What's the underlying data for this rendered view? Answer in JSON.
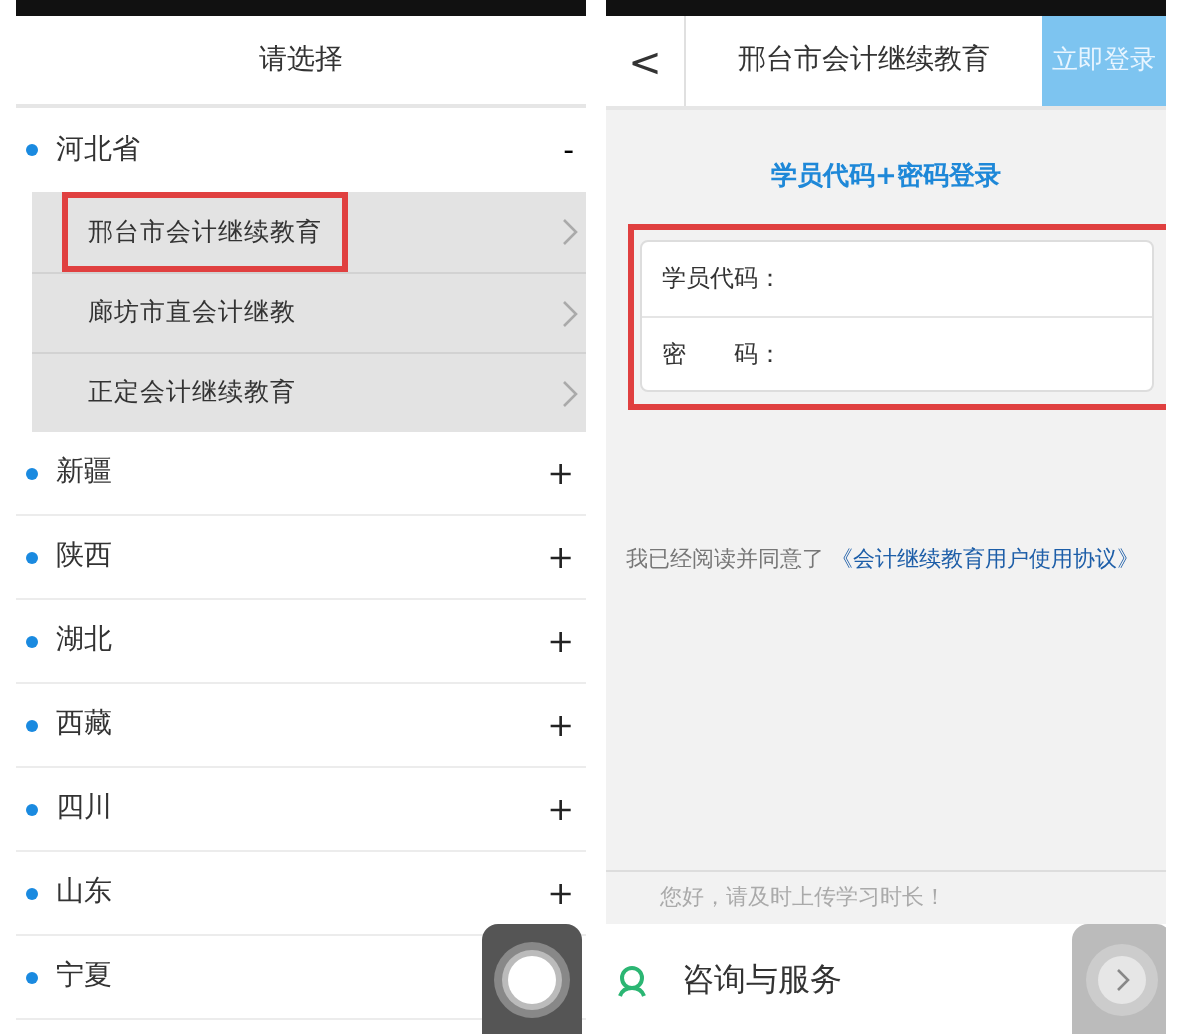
{
  "left_screen": {
    "title": "请选择",
    "provinces": [
      {
        "name": "河北省",
        "expanded": true,
        "toggle": "-",
        "children": [
          {
            "name": "邢台市会计继续教育",
            "highlighted": true
          },
          {
            "name": "廊坊市直会计继教",
            "highlighted": false
          },
          {
            "name": "正定会计继续教育",
            "highlighted": false
          }
        ]
      },
      {
        "name": "新疆",
        "expanded": false,
        "toggle": "+"
      },
      {
        "name": "陕西",
        "expanded": false,
        "toggle": "+"
      },
      {
        "name": "湖北",
        "expanded": false,
        "toggle": "+"
      },
      {
        "name": "西藏",
        "expanded": false,
        "toggle": "+"
      },
      {
        "name": "四川",
        "expanded": false,
        "toggle": "+"
      },
      {
        "name": "山东",
        "expanded": false,
        "toggle": "+"
      },
      {
        "name": "宁夏",
        "expanded": false
      }
    ]
  },
  "right_screen": {
    "back": "<",
    "title": "邢台市会计继续教育",
    "login_button": "立即登录",
    "form_title": "学员代码+密码登录",
    "form_highlighted": true,
    "fields": [
      {
        "label": "学员代码："
      },
      {
        "label": "密　　码："
      }
    ],
    "agreement": {
      "text": "我已经阅读并同意了",
      "link": "《会计继续教育用户使用协议》"
    },
    "notice": "您好，请及时上传学习时长！",
    "service": "咨询与服务"
  }
}
